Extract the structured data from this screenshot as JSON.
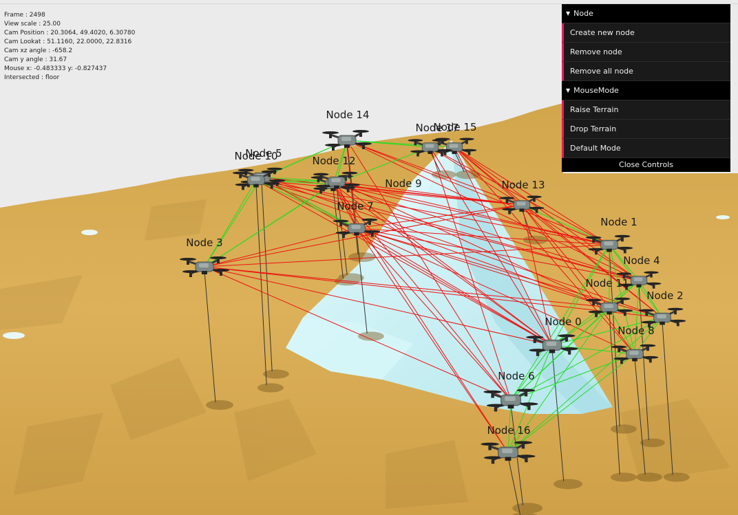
{
  "stats": {
    "frame": "Frame : 2498",
    "view_scale": "View scale : 25.00",
    "cam_position": "Cam Position : 20.3064, 49.4020, 6.30780",
    "cam_lookat": "Cam Lookat : 51.1160, 22.0000, 22.8316",
    "cam_xz_angle": "Cam xz angle : -658.2",
    "cam_y_angle": "Cam y angle : 31.67",
    "mouse": "Mouse x: -0.483333 y: -0.827437",
    "intersected": "Intersected : floor"
  },
  "gui": {
    "folders": [
      {
        "title": "Node",
        "items": [
          "Create new node",
          "Remove node",
          "Remove all node"
        ]
      },
      {
        "title": "MouseMode",
        "items": [
          "Raise Terrain",
          "Drop Terrain",
          "Default Mode"
        ]
      }
    ],
    "close_label": "Close Controls",
    "accent_color": "#e61d5f"
  },
  "scene": {
    "node_labels": [
      "Node 0",
      "Node 1",
      "Node 2",
      "Node 3",
      "Node 4",
      "Node 5",
      "Node 6",
      "Node 7",
      "Node 8",
      "Node 9",
      "Node 10",
      "Node 11",
      "Node 12",
      "Node 13",
      "Node 14",
      "Node 15",
      "Node 16",
      "Node 17"
    ],
    "colors": {
      "sky": "#ebebeb",
      "terrain": "#d8ad52",
      "mountain": "#c8f0f4",
      "link_good": "#22dd22",
      "link_bad": "#ee1111"
    }
  }
}
